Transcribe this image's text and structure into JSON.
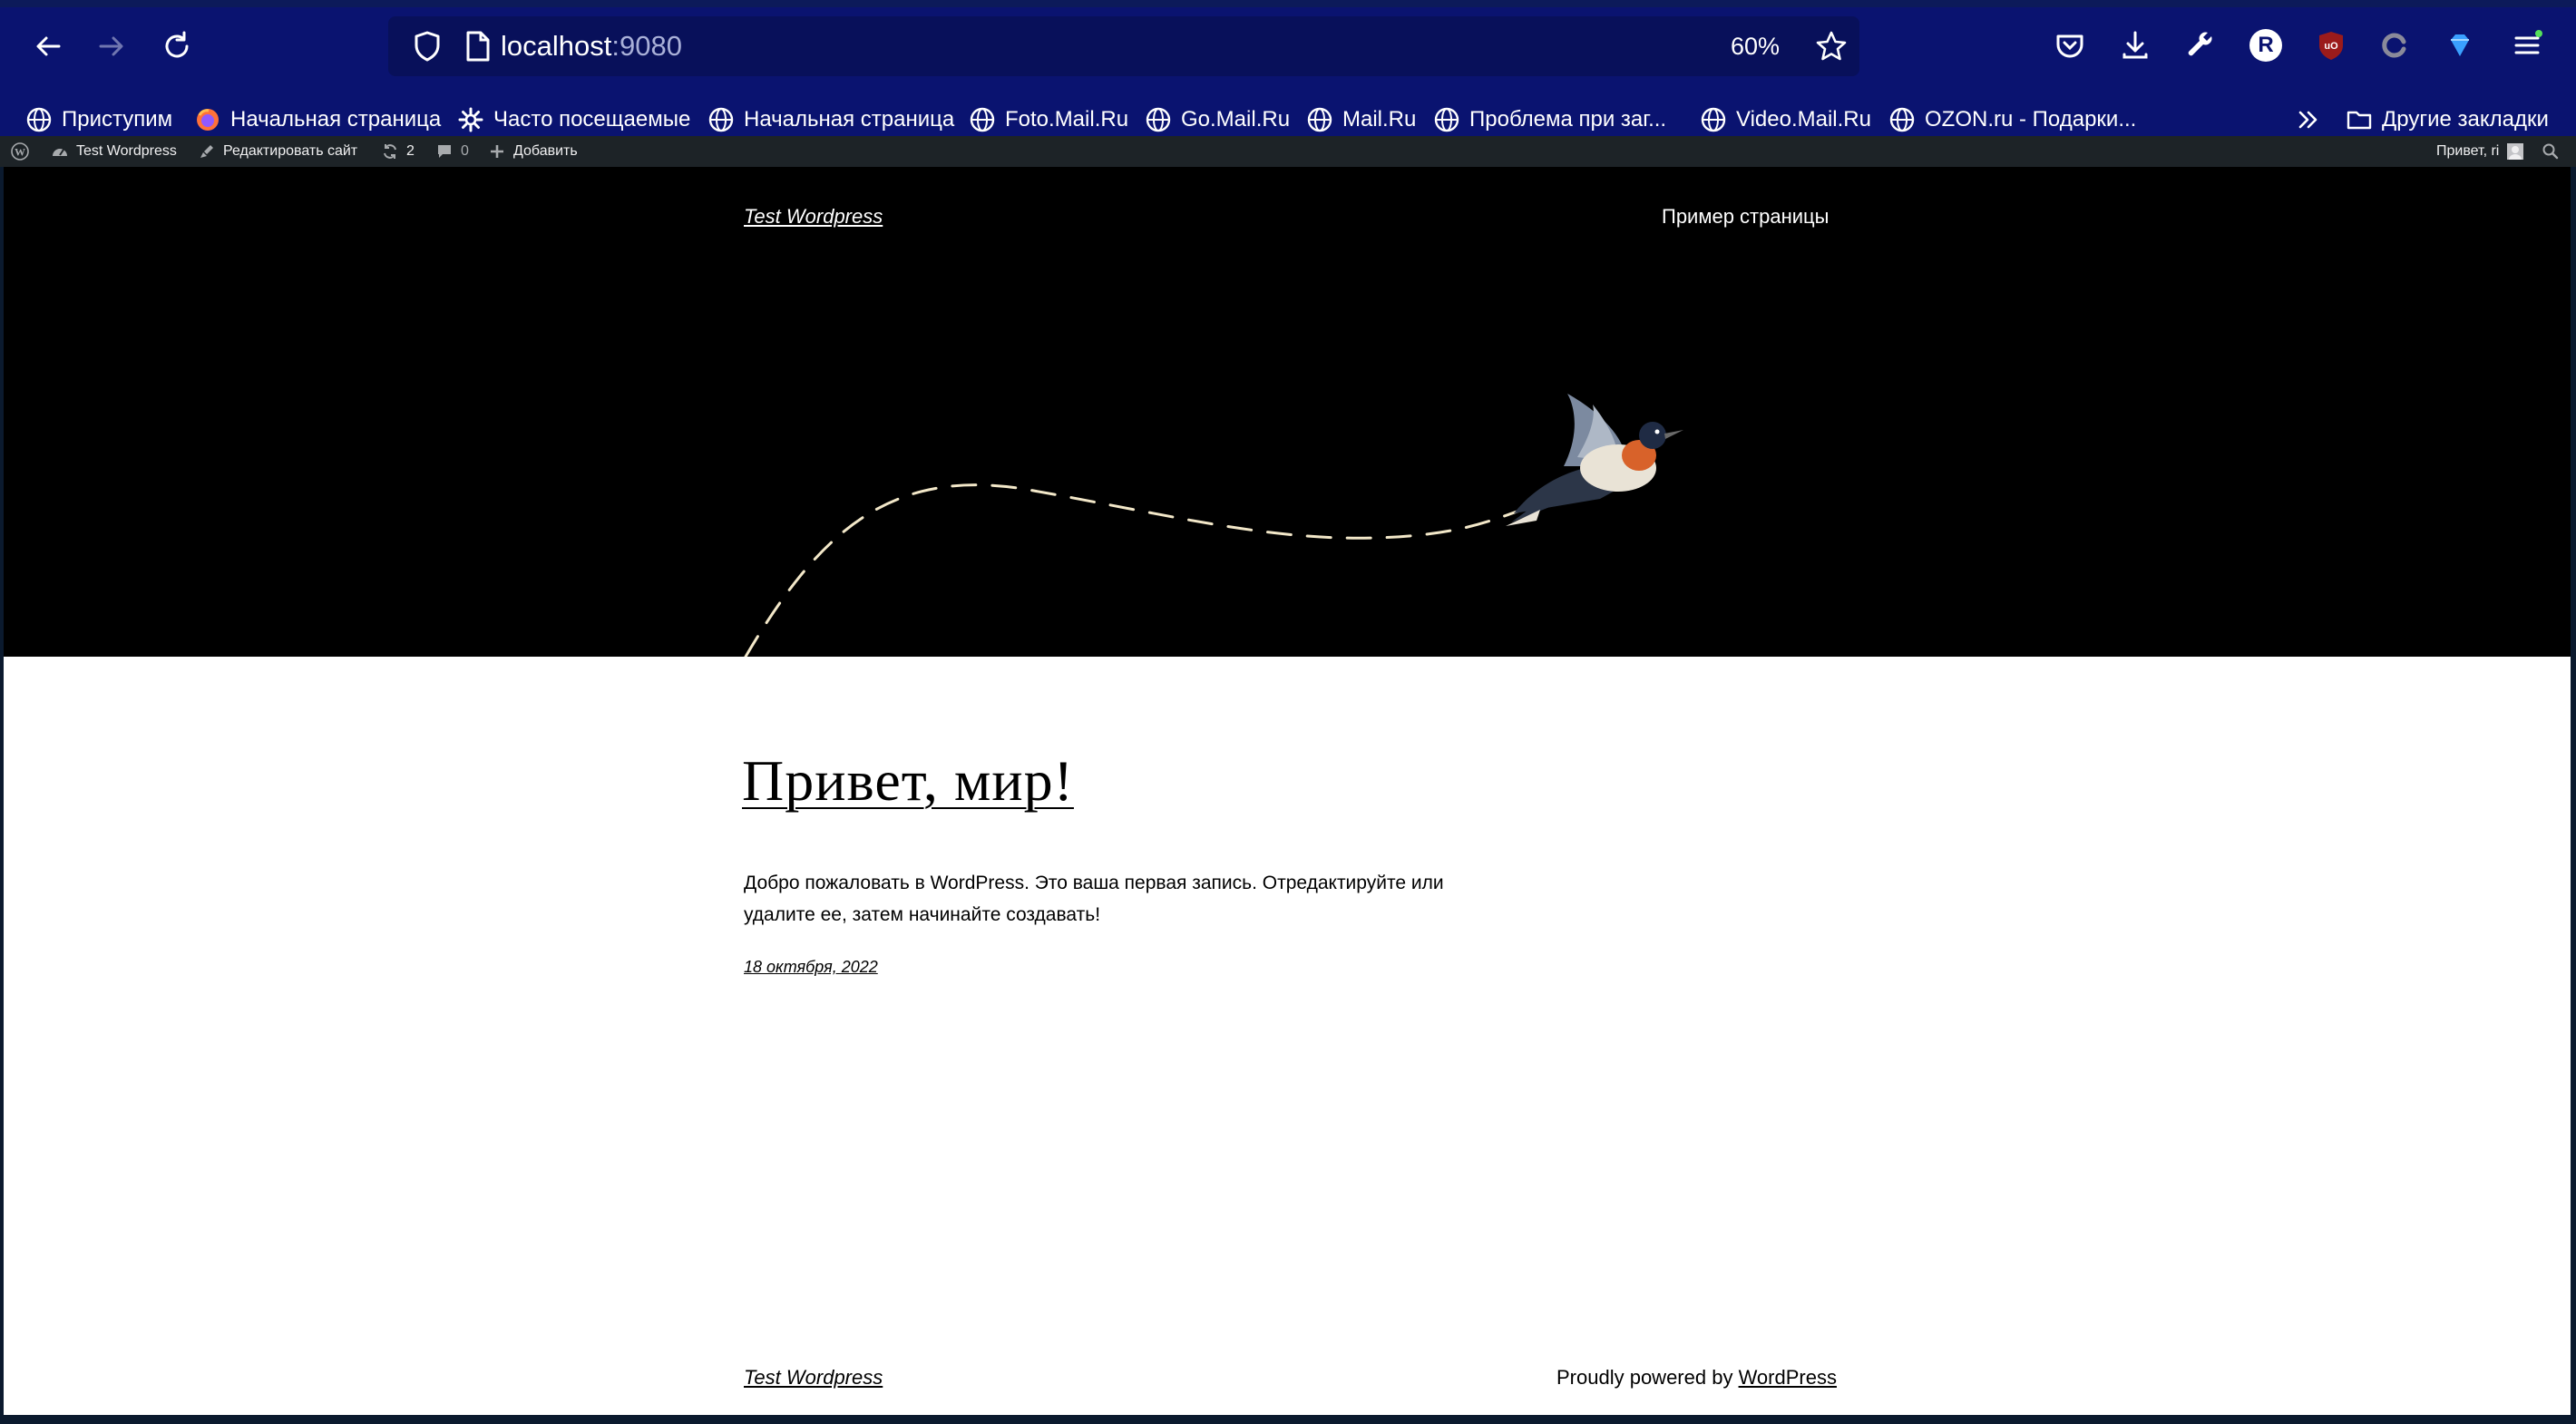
{
  "browser": {
    "url_host": "localhost",
    "url_port": ":9080",
    "zoom": "60%",
    "profile_initial": "R"
  },
  "bookmarks": [
    {
      "label": "Приступим",
      "icon": "globe-icon"
    },
    {
      "label": "Начальная страница",
      "icon": "firefox-icon"
    },
    {
      "label": "Часто посещаемые",
      "icon": "gear-icon"
    },
    {
      "label": "Начальная страница",
      "icon": "globe-icon"
    },
    {
      "label": "Foto.Mail.Ru",
      "icon": "globe-icon"
    },
    {
      "label": "Go.Mail.Ru",
      "icon": "globe-icon"
    },
    {
      "label": "Mail.Ru",
      "icon": "globe-icon"
    },
    {
      "label": "Проблема при заг...",
      "icon": "globe-icon"
    },
    {
      "label": "Video.Mail.Ru",
      "icon": "globe-icon"
    },
    {
      "label": "OZON.ru - Подарки...",
      "icon": "globe-icon"
    }
  ],
  "other_bookmarks": "Другие закладки",
  "adminbar": {
    "site_name": "Test Wordpress",
    "edit_site": "Редактировать сайт",
    "updates_count": "2",
    "comments_count": "0",
    "add_new": "Добавить",
    "greeting": "Привет, ri"
  },
  "site": {
    "title": "Test Wordpress",
    "nav_page": "Пример страницы"
  },
  "post": {
    "title": "Привет, мир!",
    "excerpt": "Добро пожаловать в WordPress. Это ваша первая запись. Отредактируйте или удалите ее, затем начинайте создавать!",
    "date": "18 октября, 2022"
  },
  "footer": {
    "site_title": "Test Wordpress",
    "powered_prefix": "Proudly powered by ",
    "powered_link": "WordPress"
  }
}
